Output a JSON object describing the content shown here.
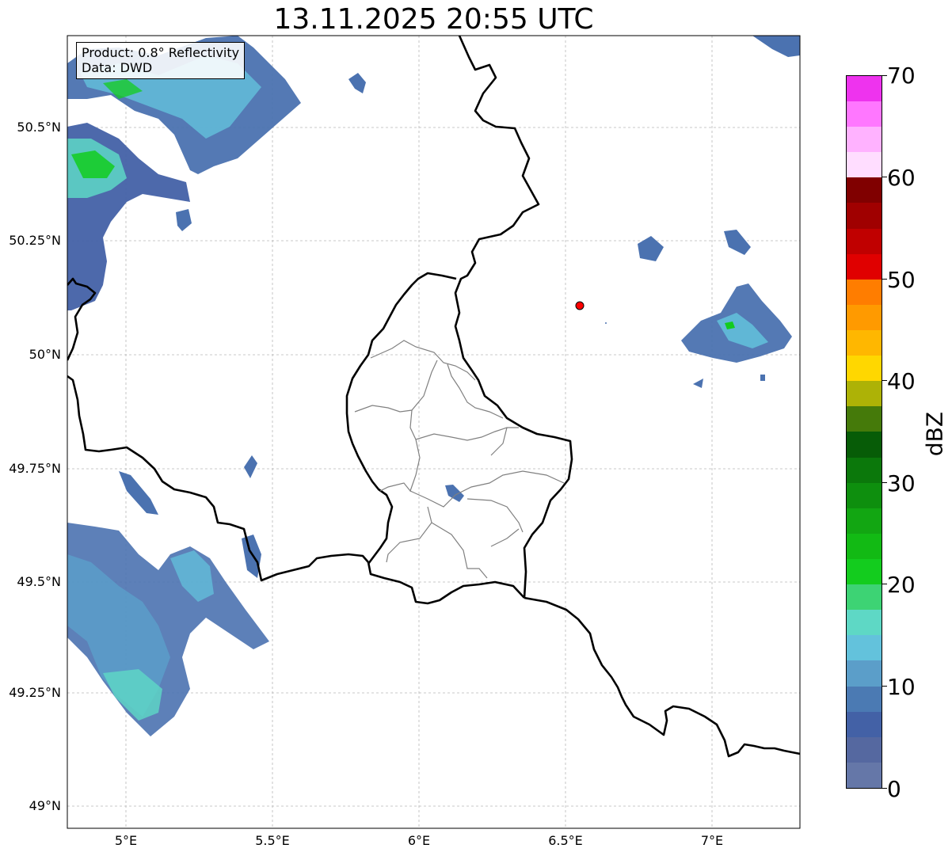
{
  "title": "13.11.2025 20:55 UTC",
  "info": {
    "product": "Product: 0.8° Reflectivity",
    "data": "Data: DWD"
  },
  "lat_labels": [
    "49°N",
    "49.25°N",
    "49.5°N",
    "49.75°N",
    "50°N",
    "50.25°N",
    "50.5°N"
  ],
  "lon_labels": [
    "5°E",
    "5.5°E",
    "6°E",
    "6.5°E",
    "7°E"
  ],
  "colorbar": {
    "label": "dBZ",
    "ticks": [
      "0",
      "10",
      "20",
      "30",
      "40",
      "50",
      "60",
      "70"
    ],
    "colors": [
      "#6577a8",
      "#5568a0",
      "#4361a6",
      "#4b7ab3",
      "#5b9ec9",
      "#63c2dc",
      "#5ed8c5",
      "#3dd374",
      "#13cc1e",
      "#12ba14",
      "#12a612",
      "#0e8f0e",
      "#0b780b",
      "#075c07",
      "#457a0a",
      "#adb206",
      "#ffd700",
      "#ffb700",
      "#ff9a00",
      "#ff7d00",
      "#e00000",
      "#c00000",
      "#a00000",
      "#800000",
      "#ffddff",
      "#ffb2ff",
      "#ff77ff",
      "#ee33ee"
    ]
  },
  "marker": {
    "lat": 50.11,
    "lon": 6.55,
    "color": "#ff0000"
  }
}
